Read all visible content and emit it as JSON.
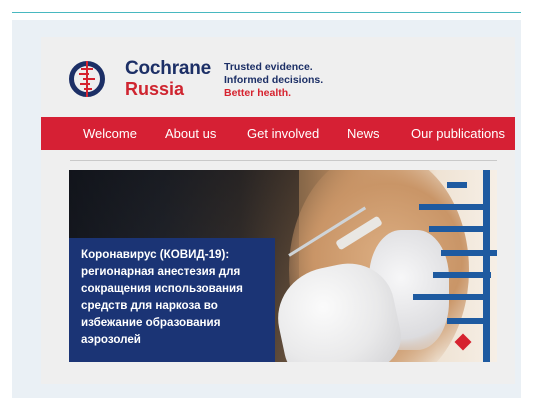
{
  "brand": {
    "name": "Cochrane",
    "region": "Russia",
    "tagline_line1": "Trusted evidence.",
    "tagline_line2": "Informed decisions.",
    "tagline_line3": "Better health."
  },
  "nav": {
    "items": [
      {
        "label": "Welcome"
      },
      {
        "label": "About us"
      },
      {
        "label": "Get involved"
      },
      {
        "label": "News"
      },
      {
        "label": "Our publications"
      }
    ]
  },
  "hero": {
    "headline_lines": [
      "Коронавирус (КОВИД-19):",
      "регионарная анестезия для",
      "сокращения использования",
      "средств для наркоза во",
      "избежание образования",
      "аэрозолей"
    ]
  },
  "colors": {
    "brand_navy": "#1c2f66",
    "brand_red": "#d62034",
    "hero_panel": "#1b3475",
    "accent_teal": "#48b8c0",
    "graphic_blue": "#1e5aa0"
  },
  "icons": {
    "logo": "cochrane-logo-icon",
    "forest_plot": "forest-plot-graphic"
  }
}
